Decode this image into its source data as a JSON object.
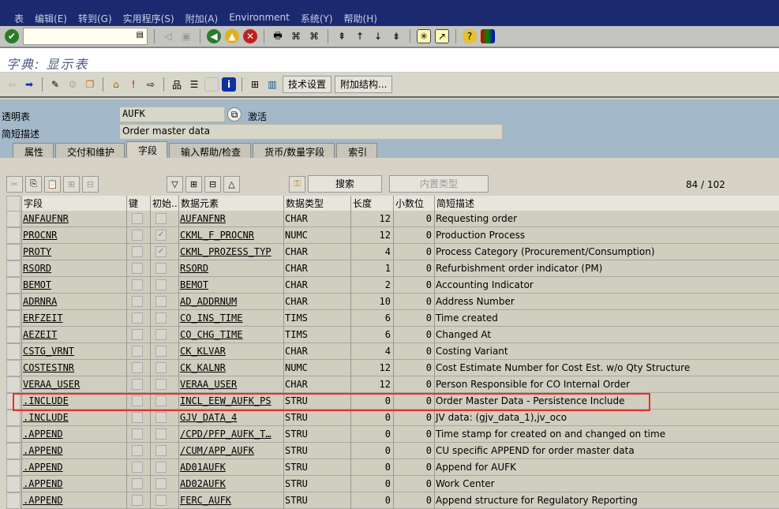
{
  "menu": [
    "表",
    "编辑(E)",
    "转到(G)",
    "实用程序(S)",
    "附加(A)",
    "Environment",
    "系统(Y)",
    "帮助(H)"
  ],
  "title": "字典: 显示表",
  "app_toolbar": {
    "tech_settings": "技术设置",
    "append_structure": "附加结构..."
  },
  "header": {
    "table_label": "透明表",
    "table_value": "AUFK",
    "status": "激活",
    "desc_label": "简短描述",
    "desc_value": "Order master data"
  },
  "tabs": [
    "属性",
    "交付和维护",
    "字段",
    "输入帮助/检查",
    "货币/数量字段",
    "索引"
  ],
  "active_tab": 2,
  "table_toolbar": {
    "search": "搜索",
    "builtin_type": "内置类型",
    "position": "84 / 102"
  },
  "columns": [
    "字段",
    "键",
    "初始...",
    "数据元素",
    "数据类型",
    "长度",
    "小数位",
    "简短描述"
  ],
  "rows": [
    [
      "ANFAUFNR",
      false,
      false,
      "AUFANFNR",
      "CHAR",
      12,
      0,
      "Requesting order"
    ],
    [
      "PROCNR",
      false,
      true,
      "CKML_F_PROCNR",
      "NUMC",
      12,
      0,
      "Production Process"
    ],
    [
      "PROTY",
      false,
      true,
      "CKML_PROZESS_TYP",
      "CHAR",
      4,
      0,
      "Process Category (Procurement/Consumption)"
    ],
    [
      "RSORD",
      false,
      false,
      "RSORD",
      "CHAR",
      1,
      0,
      "Refurbishment order indicator (PM)"
    ],
    [
      "BEMOT",
      false,
      false,
      "BEMOT",
      "CHAR",
      2,
      0,
      "Accounting Indicator"
    ],
    [
      "ADRNRA",
      false,
      false,
      "AD_ADDRNUM",
      "CHAR",
      10,
      0,
      "Address Number"
    ],
    [
      "ERFZEIT",
      false,
      false,
      "CO_INS_TIME",
      "TIMS",
      6,
      0,
      "Time created"
    ],
    [
      "AEZEIT",
      false,
      false,
      "CO_CHG_TIME",
      "TIMS",
      6,
      0,
      "Changed At"
    ],
    [
      "CSTG_VRNT",
      false,
      false,
      "CK_KLVAR",
      "CHAR",
      4,
      0,
      "Costing Variant"
    ],
    [
      "COSTESTNR",
      false,
      false,
      "CK_KALNR",
      "NUMC",
      12,
      0,
      "Cost Estimate Number for Cost Est. w/o Qty Structure"
    ],
    [
      "VERAA_USER",
      false,
      false,
      "VERAA_USER",
      "CHAR",
      12,
      0,
      "Person Responsible for CO Internal Order"
    ],
    [
      ".INCLUDE",
      false,
      false,
      "INCL_EEW_AUFK_PS",
      "STRU",
      0,
      0,
      "Order Master Data - Persistence Include"
    ],
    [
      ".INCLUDE",
      false,
      false,
      "GJV_DATA_4",
      "STRU",
      0,
      0,
      "JV data: (gjv_data_1),jv_oco"
    ],
    [
      ".APPEND",
      false,
      false,
      "/CPD/PFP_AUFK_T…",
      "STRU",
      0,
      0,
      "Time stamp for created on and changed on time"
    ],
    [
      ".APPEND",
      false,
      false,
      "/CUM/APP_AUFK",
      "STRU",
      0,
      0,
      "CU specific APPEND for order master data"
    ],
    [
      ".APPEND",
      false,
      false,
      "AD01AUFK",
      "STRU",
      0,
      0,
      "Append for AUFK"
    ],
    [
      ".APPEND",
      false,
      false,
      "AD02AUFK",
      "STRU",
      0,
      0,
      "Work Center"
    ],
    [
      ".APPEND",
      false,
      false,
      "FERC_AUFK",
      "STRU",
      0,
      0,
      "Append structure for Regulatory Reporting"
    ]
  ],
  "highlight_color": "#e83030"
}
